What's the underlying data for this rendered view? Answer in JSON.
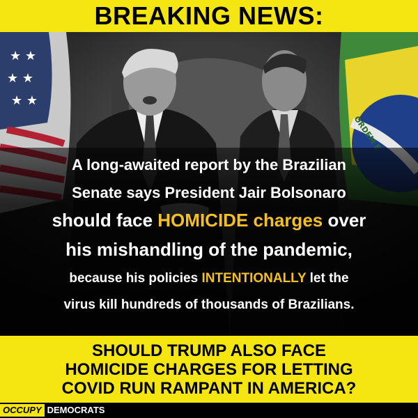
{
  "header": {
    "title": "BREAKING NEWS:"
  },
  "photo": {
    "flag_text": "ORDEM E"
  },
  "caption": {
    "line1": "A long-awaited report by the Brazilian",
    "line2": "Senate says President Jair Bolsonaro",
    "line3_pre": "should face ",
    "line3_hl1": "HOMICIDE",
    "line3_mid": " ",
    "line3_hl2": "charges",
    "line3_post": " over",
    "line4": "his mishandling of the pandemic,",
    "line5_pre": "because his policies ",
    "line5_hl": "INTENTIONALLY",
    "line5_post": " let the",
    "line6": "virus kill hundreds of thousands of Brazilians."
  },
  "question": {
    "line1": "SHOULD TRUMP ALSO FACE",
    "line2": "HOMICIDE CHARGES FOR LETTING",
    "line3": "COVID RUN RAMPANT IN AMERICA?"
  },
  "logo": {
    "part1": "OCCUPY",
    "part2": "DEMOCRATS"
  },
  "colors": {
    "banner": "#f5e612",
    "highlight": "#f5c023"
  }
}
